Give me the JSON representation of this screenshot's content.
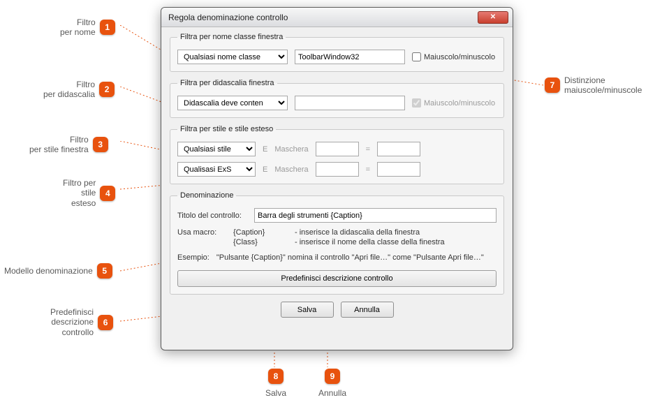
{
  "annotations": {
    "a1": {
      "num": "1",
      "label": "Filtro\nper nome"
    },
    "a2": {
      "num": "2",
      "label": "Filtro\nper didascalia"
    },
    "a3": {
      "num": "3",
      "label": "Filtro\nper stile finestra"
    },
    "a4": {
      "num": "4",
      "label": "Filtro per\nstile\nesteso"
    },
    "a5": {
      "num": "5",
      "label": "Modello denominazione"
    },
    "a6": {
      "num": "6",
      "label": "Predefinisci\ndescrizione\ncontrollo"
    },
    "a7": {
      "num": "7",
      "label": "Distinzione\nmaiuscole/minuscole"
    },
    "a8": {
      "num": "8",
      "label": "Salva"
    },
    "a9": {
      "num": "9",
      "label": "Annulla"
    }
  },
  "dialog": {
    "title": "Regola denominazione controllo",
    "close_icon": "✕",
    "groups": {
      "classname": {
        "legend": "Filtra per nome classe finestra",
        "combo": "Qualsiasi nome classe",
        "value": "ToolbarWindow32",
        "case_label": "Maiuscolo/minuscolo"
      },
      "caption": {
        "legend": "Filtra per didascalia finestra",
        "combo": "Didascalia deve contenere",
        "value": "",
        "case_label": "Maiuscolo/minuscolo"
      },
      "style": {
        "legend": "Filtra per stile e stile esteso",
        "style_combo": "Qualsiasi stile",
        "exstyle_combo": "Qualisasi ExStyle",
        "e_label": "E",
        "mask_label": "Maschera",
        "eq": "="
      },
      "naming": {
        "legend": "Denominazione",
        "title_label": "Titolo del controllo:",
        "title_value": "Barra degli strumenti {Caption}",
        "usa_macro": "Usa macro:",
        "macro1": "{Caption}",
        "macro1desc": "- inserisce la didascalia della finestra",
        "macro2": "{Class}",
        "macro2desc": "- inserisce il nome della classe della finestra",
        "example_label": "Esempio:",
        "example_text": "\"Pulsante {Caption}\" nomina il controllo \"Apri file…\" come \"Pulsante Apri file…\"",
        "preset_btn": "Predefinisci descrizione controllo"
      }
    },
    "actions": {
      "save": "Salva",
      "cancel": "Annulla"
    }
  }
}
